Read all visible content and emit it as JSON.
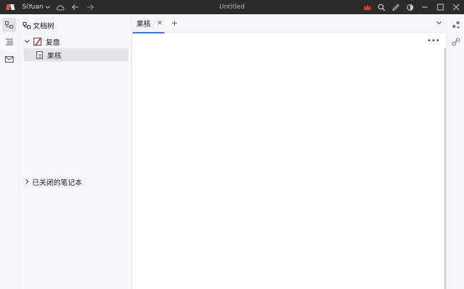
{
  "titlebar": {
    "workspace": "SiYuan",
    "title": "Untitled"
  },
  "filetree": {
    "header": "文档树",
    "notebook": "复盘",
    "doc": "果核",
    "closed_section": "已关闭的笔记本"
  },
  "tabs": [
    {
      "label": "果核"
    }
  ],
  "colors": {
    "titlebar_bg": "#2b2b2b",
    "accent": "#3575f0",
    "crown": "#e03c31",
    "panel_bg": "#f5f6f8"
  },
  "icons": {
    "workspace_caret": "chevron-down-icon",
    "cloud": "cloud-icon",
    "back": "arrow-left-icon",
    "forward": "arrow-right-icon",
    "crown": "crown-icon",
    "search": "search-icon",
    "pen": "pen-icon",
    "theme": "contrast-icon"
  }
}
